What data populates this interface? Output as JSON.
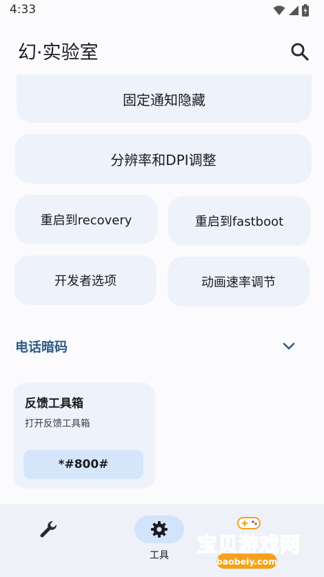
{
  "status_bar": {
    "time": "4:33"
  },
  "app_bar": {
    "title": "幻·实验室"
  },
  "tiles": {
    "hide_notification": "固定通知隐藏",
    "resolution_dpi": "分辨率和DPI调整",
    "reboot_recovery": "重启到recovery",
    "reboot_fastboot": "重启到fastboot",
    "developer_options": "开发者选项",
    "animation_speed": "动画速率调节"
  },
  "section": {
    "title": "电话暗码"
  },
  "code_card": {
    "title": "反馈工具箱",
    "subtitle": "打开反馈工具箱",
    "code": "*#800#"
  },
  "bottom_nav": {
    "items": [
      {
        "icon": "wrench-icon",
        "label": ""
      },
      {
        "icon": "gear-icon",
        "label": "工具",
        "active": true
      }
    ]
  },
  "watermark": {
    "text": "宝贝游戏网",
    "url": "baobeiy.com"
  },
  "colors": {
    "accent": "#2f5b86",
    "tile_bg": "#eef2fa",
    "chip_bg": "#d5e6fb",
    "nav_bg": "#eef1f8"
  }
}
